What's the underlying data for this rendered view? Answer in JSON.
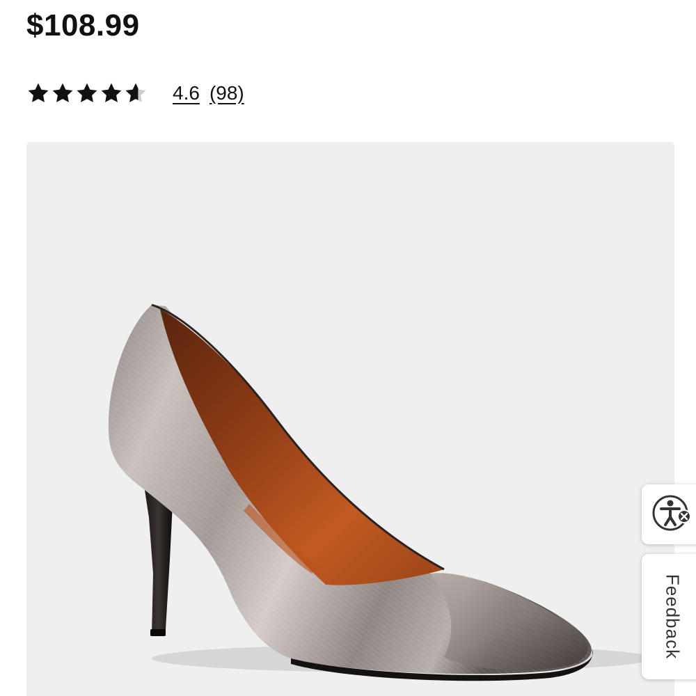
{
  "product": {
    "price": "$108.99",
    "rating": {
      "value": "4.6",
      "count": "(98)",
      "stars": 4.6,
      "max_stars": 5,
      "star_color": "#111111",
      "empty_star_color": "#cccccc"
    },
    "image": {
      "icon": "metallic-pointed-toe-pump-shoe",
      "background_color": "#efefef"
    }
  },
  "side_widgets": {
    "accessibility": {
      "icon": "accessibility-person-icon",
      "badge_icon": "close-icon"
    },
    "feedback": {
      "label": "Feedback"
    }
  }
}
